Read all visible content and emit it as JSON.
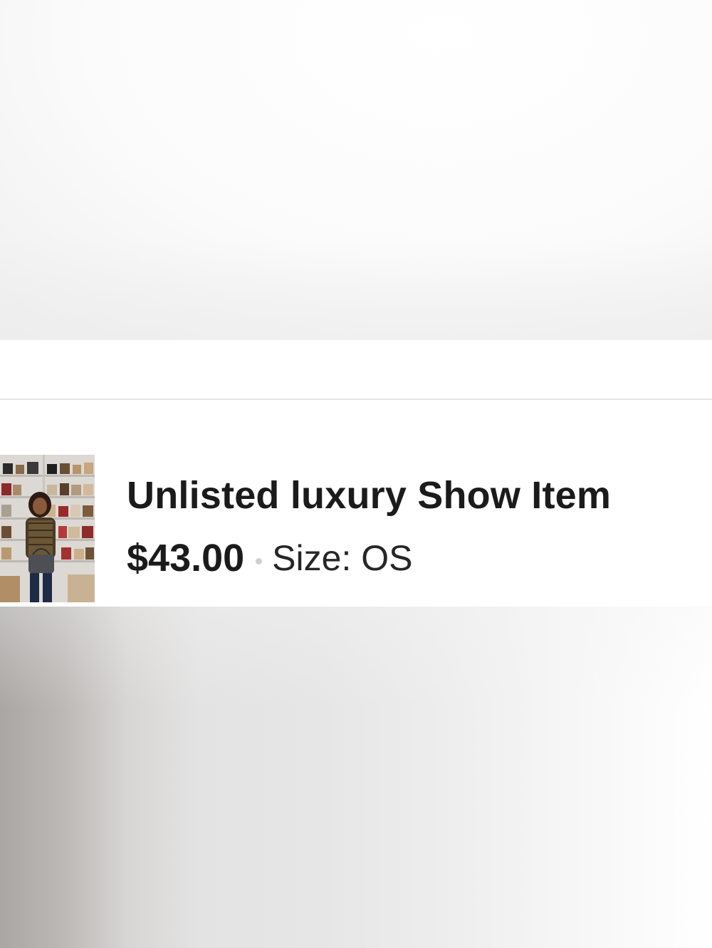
{
  "listing": {
    "title": "Unlisted luxury Show Item",
    "price": "$43.00",
    "size_text": "Size: OS",
    "thumbnail_icon": "listing-photo-icon"
  },
  "colors": {
    "text_primary": "#1b1b1b",
    "separator_dot": "#cfcfcf",
    "divider": "#e6e6e6"
  }
}
